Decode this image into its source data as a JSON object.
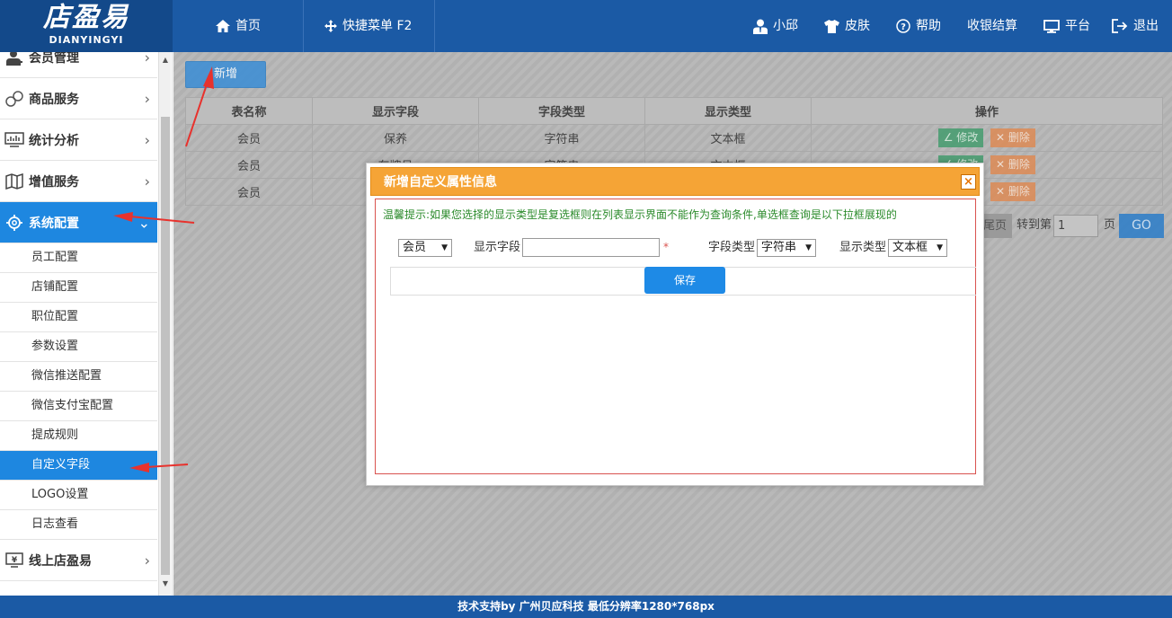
{
  "header": {
    "logo_main": "店盈易",
    "logo_sub": "DIANYINGYI",
    "nav_home": "首页",
    "nav_shortcut": "快捷菜单 F2",
    "nav_user": "小邱",
    "nav_skin": "皮肤",
    "nav_help": "帮助",
    "nav_checkout": "收银结算",
    "nav_platform": "平台",
    "nav_logout": "退出"
  },
  "sidebar": {
    "menus": [
      {
        "label": "会员管理",
        "icon": "user-icon"
      },
      {
        "label": "商品服务",
        "icon": "goods-icon"
      },
      {
        "label": "统计分析",
        "icon": "chart-icon"
      },
      {
        "label": "增值服务",
        "icon": "map-icon"
      },
      {
        "label": "系统配置",
        "icon": "settings-icon",
        "active": true
      }
    ],
    "submenu": [
      "员工配置",
      "店铺配置",
      "职位配置",
      "参数设置",
      "微信推送配置",
      "微信支付宝配置",
      "提成规则",
      "自定义字段",
      "LOGO设置",
      "日志查看"
    ],
    "active_submenu": "自定义字段",
    "online_label": "线上店盈易"
  },
  "main": {
    "add_button": "新增",
    "table": {
      "headers": [
        "表名称",
        "显示字段",
        "字段类型",
        "显示类型",
        "操作"
      ],
      "rows": [
        [
          "会员",
          "保养",
          "字符串",
          "文本框"
        ],
        [
          "会员",
          "车牌号",
          "字符串",
          "文本框"
        ],
        [
          "会员",
          "",
          "",
          ""
        ]
      ],
      "edit_label": "修改",
      "delete_label": "删除"
    },
    "pager": {
      "prev_label": "尾页",
      "goto_label": "转到第",
      "page_value": "1",
      "page_unit": "页",
      "go_label": "GO"
    }
  },
  "modal": {
    "title": "新增自定义属性信息",
    "close": "×",
    "tip": "温馨提示:如果您选择的显示类型是复选框则在列表显示界面不能作为查询条件,单选框查询是以下拉框展现的",
    "table_select": "会员",
    "field_label": "显示字段",
    "field_value": "",
    "required_mark": "*",
    "type_label": "字段类型",
    "type_select": "字符串",
    "display_label": "显示类型",
    "display_select": "文本框",
    "save_button": "保存"
  },
  "footer": {
    "text": "技术支持by 广州贝应科技   最低分辨率1280*768px"
  },
  "colors": {
    "header_bg": "#1b5aa5",
    "active_blue": "#1e87e0",
    "modal_head": "#f5a436",
    "annotation_red": "#e8322d"
  }
}
